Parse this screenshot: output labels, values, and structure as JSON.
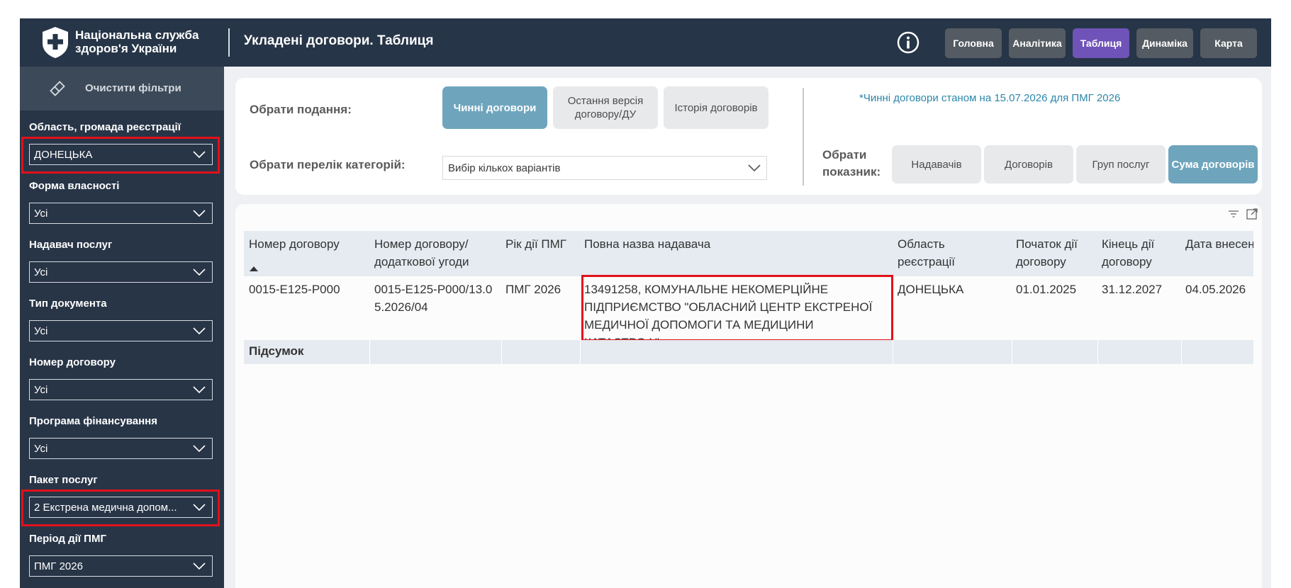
{
  "header": {
    "org_line1": "Національна служба",
    "org_line2": "здоров'я України",
    "title": "Укладені договори. Таблиця",
    "info_icon": "info-icon",
    "nav": [
      {
        "label": "Головна",
        "active": false
      },
      {
        "label": "Аналітика",
        "active": false
      },
      {
        "label": "Таблиця",
        "active": true
      },
      {
        "label": "Динаміка",
        "active": false
      },
      {
        "label": "Карта",
        "active": false
      }
    ]
  },
  "sidebar": {
    "clear_label": "Очистити фільтри",
    "clear_icon": "eraser-icon",
    "filters": [
      {
        "label": "Область, громада реєстрації",
        "value": "ДОНЕЦЬКА",
        "highlighted": true
      },
      {
        "label": "Форма власності",
        "value": "Усі"
      },
      {
        "label": "Надавач послуг",
        "value": "Усі"
      },
      {
        "label": "Тип документа",
        "value": "Усі"
      },
      {
        "label": "Номер договору",
        "value": "Усі"
      },
      {
        "label": "Програма фінансування",
        "value": "Усі"
      },
      {
        "label": "Пакет послуг",
        "value": "2 Екстрена медична допом...",
        "highlighted": true
      },
      {
        "label": "Період дії ПМГ",
        "value": "ПМГ 2026"
      }
    ]
  },
  "controls": {
    "submission_label": "Обрати подання:",
    "submission_options": [
      "Чинні договори",
      "Остання версія договору/ДУ",
      "Історія договорів"
    ],
    "submission_selected": "Чинні договори",
    "categories_label": "Обрати перелік категорій:",
    "categories_value": "Вибір кількох варіантів",
    "indicator_label": "Обрати показник:",
    "indicator_options": [
      "Надавачів",
      "Договорів",
      "Груп послуг",
      "Сума договорів"
    ],
    "indicator_selected": "Сума договорів",
    "note": "*Чинні договори станом на 15.07.2026 для ПМГ 2026"
  },
  "table": {
    "columns": [
      "Номер договору",
      "Номер договору/ додаткової угоди",
      "Рік дії ПМГ",
      "Повна назва надавача",
      "Область реєстрації",
      "Початок дії договору",
      "Кінець дії договору",
      "Дата внесення зм"
    ],
    "sort_column": "Номер договору",
    "rows": [
      [
        "0015-Е125-Р000",
        "0015-Е125-Р000/13.05.2026/04",
        "ПМГ 2026",
        "13491258, КОМУНАЛЬНЕ НЕКОМЕРЦІЙНЕ ПІДПРИЄМСТВО \"ОБЛАСНИЙ ЦЕНТР ЕКСТРЕНОЇ МЕДИЧНОЇ ДОПОМОГИ ТА МЕДИЦИНИ КАТАСТРОФ\"",
        "ДОНЕЦЬКА",
        "01.01.2025",
        "31.12.2027",
        "04.05.2026"
      ]
    ],
    "total_label": "Підсумок",
    "highlight_cell": "Повна назва надавача"
  },
  "colors": {
    "topbar": "#263547",
    "sidebar": "#283547",
    "nav_active": "#6f53b8",
    "nav_default": "#555b62",
    "segment_active": "#6ea5bd",
    "highlight": "#e3101a",
    "note_text": "#2d87a8"
  }
}
